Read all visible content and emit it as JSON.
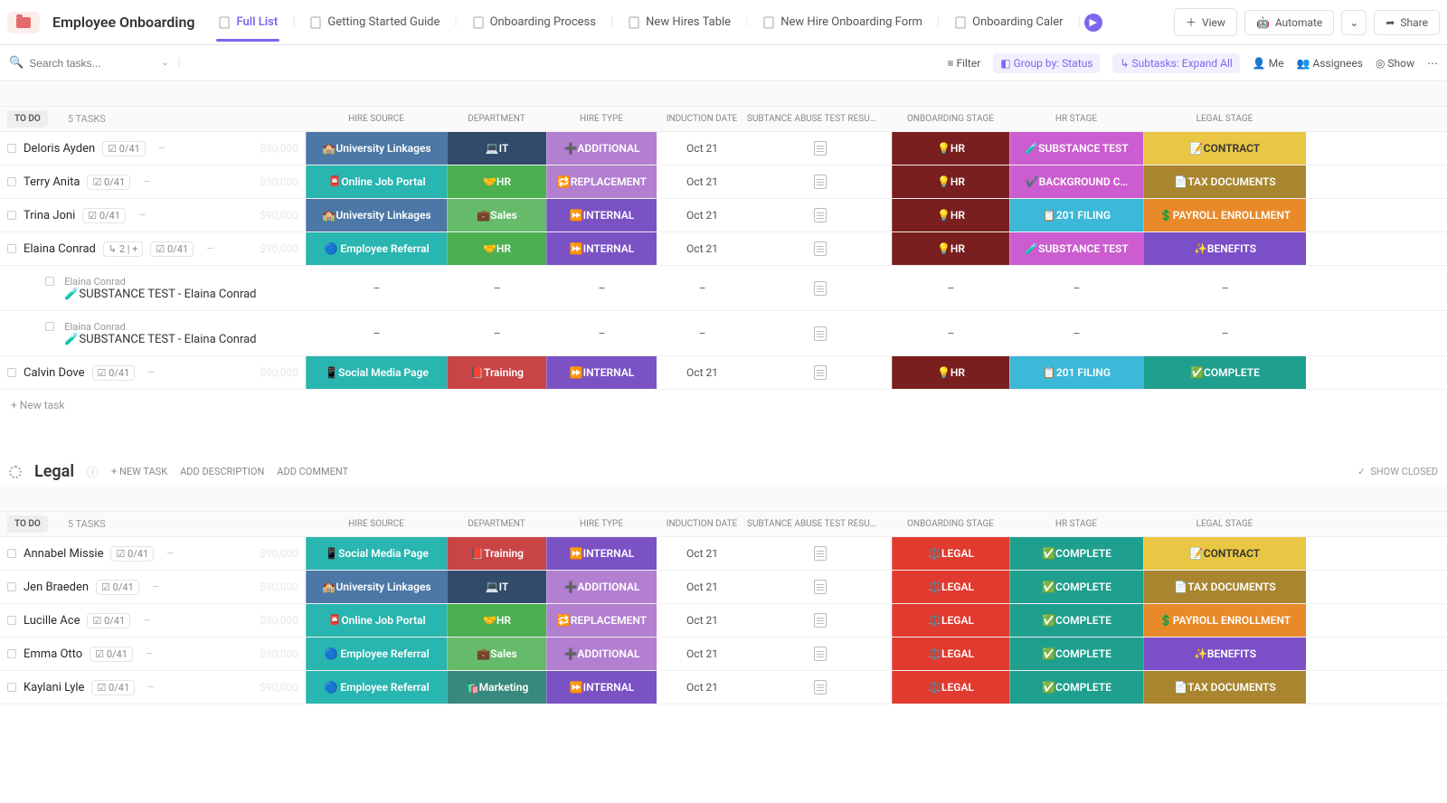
{
  "header": {
    "title": "Employee Onboarding",
    "tabs": [
      {
        "label": "Full List",
        "active": true
      },
      {
        "label": "Getting Started Guide"
      },
      {
        "label": "Onboarding Process"
      },
      {
        "label": "New Hires Table"
      },
      {
        "label": "New Hire Onboarding Form"
      },
      {
        "label": "Onboarding Caler"
      }
    ],
    "view_btn": "View",
    "automate_btn": "Automate",
    "share_btn": "Share"
  },
  "toolbar": {
    "search_placeholder": "Search tasks...",
    "filter": "Filter",
    "group_by": "Group by: Status",
    "subtasks": "Subtasks: Expand All",
    "me": "Me",
    "assignees": "Assignees",
    "show": "Show"
  },
  "columns": [
    "HIRE SOURCE",
    "DEPARTMENT",
    "HIRE TYPE",
    "INDUCTION DATE",
    "SUBTANCE ABUSE TEST RESU…",
    "ONBOARDING STAGE",
    "HR STAGE",
    "LEGAL STAGE"
  ],
  "group1": {
    "status": "TO DO",
    "task_count": "5 TASKS",
    "new_task": "+ New task",
    "rows": [
      {
        "name": "Deloris Ayden",
        "progress": "0/41",
        "budget": "$90,000",
        "hiresource": "🏫University Linkages",
        "hiresource_bg": "bg-steel",
        "dept": "💻IT",
        "dept_bg": "bg-it",
        "hiretype": "➕ADDITIONAL",
        "hiretype_bg": "bg-violetlight",
        "induction": "Oct 21",
        "onboarding": "💡HR",
        "onboarding_bg": "bg-maroon",
        "hrstage": "🧪SUBSTANCE TEST",
        "hrstage_bg": "bg-magenta",
        "legal": "📝CONTRACT",
        "legal_bg": "bg-mustard"
      },
      {
        "name": "Terry Anita",
        "progress": "0/41",
        "budget": "$90,000",
        "hiresource": "📮Online Job Portal",
        "hiresource_bg": "bg-teal",
        "dept": "🤝HR",
        "dept_bg": "bg-hr",
        "hiretype": "🔁REPLACEMENT",
        "hiretype_bg": "bg-violetlight",
        "induction": "Oct 21",
        "onboarding": "💡HR",
        "onboarding_bg": "bg-maroon",
        "hrstage": "✔️BACKGROUND C…",
        "hrstage_bg": "bg-magenta",
        "legal": "📄TAX DOCUMENTS",
        "legal_bg": "bg-olive"
      },
      {
        "name": "Trina Joni",
        "progress": "0/41",
        "budget": "$90,000",
        "hiresource": "🏫University Linkages",
        "hiresource_bg": "bg-steel",
        "dept": "💼Sales",
        "dept_bg": "bg-sales",
        "hiretype": "⏩INTERNAL",
        "hiretype_bg": "bg-violet",
        "induction": "Oct 21",
        "onboarding": "💡HR",
        "onboarding_bg": "bg-maroon",
        "hrstage": "📋201 FILING",
        "hrstage_bg": "bg-cyan",
        "legal": "💲PAYROLL ENROLLMENT",
        "legal_bg": "bg-orange"
      },
      {
        "name": "Elaina Conrad",
        "progress": "0/41",
        "budget": "$90,000",
        "subcount": "2",
        "hiresource": "🔵 Employee Referral",
        "hiresource_bg": "bg-teal",
        "dept": "🤝HR",
        "dept_bg": "bg-hr",
        "hiretype": "⏩INTERNAL",
        "hiretype_bg": "bg-violet",
        "induction": "Oct 21",
        "onboarding": "💡HR",
        "onboarding_bg": "bg-maroon",
        "hrstage": "🧪SUBSTANCE TEST",
        "hrstage_bg": "bg-magenta",
        "legal": "✨BENEFITS",
        "legal_bg": "bg-purple",
        "subtasks": [
          {
            "parent": "Elaina Conrad",
            "title": "🧪SUBSTANCE TEST - Elaina Conrad"
          },
          {
            "parent": "Elaina Conrad",
            "title": "🧪SUBSTANCE TEST - Elaina Conrad"
          }
        ]
      },
      {
        "name": "Calvin Dove",
        "progress": "0/41",
        "budget": "$90,000",
        "hiresource": "📱Social Media Page",
        "hiresource_bg": "bg-teal",
        "dept": "📕Training",
        "dept_bg": "bg-training",
        "hiretype": "⏩INTERNAL",
        "hiretype_bg": "bg-violet",
        "induction": "Oct 21",
        "onboarding": "💡HR",
        "onboarding_bg": "bg-maroon",
        "hrstage": "📋201 FILING",
        "hrstage_bg": "bg-cyan",
        "legal": "✅COMPLETE",
        "legal_bg": "bg-tealdark"
      }
    ]
  },
  "group2": {
    "name": "Legal",
    "links": {
      "new_task": "+ NEW TASK",
      "add_desc": "ADD DESCRIPTION",
      "add_comment": "ADD COMMENT",
      "show_closed": "SHOW CLOSED"
    },
    "status": "TO DO",
    "task_count": "5 TASKS",
    "rows": [
      {
        "name": "Annabel Missie",
        "progress": "0/41",
        "budget": "$90,000",
        "hiresource": "📱Social Media Page",
        "hiresource_bg": "bg-teal",
        "dept": "📕Training",
        "dept_bg": "bg-training",
        "hiretype": "⏩INTERNAL",
        "hiretype_bg": "bg-violet",
        "induction": "Oct 21",
        "onboarding": "⚖️LEGAL",
        "onboarding_bg": "bg-red",
        "hrstage": "✅COMPLETE",
        "hrstage_bg": "bg-tealdark",
        "legal": "📝CONTRACT",
        "legal_bg": "bg-mustard"
      },
      {
        "name": "Jen Braeden",
        "progress": "0/41",
        "budget": "$90,000",
        "hiresource": "🏫University Linkages",
        "hiresource_bg": "bg-steel",
        "dept": "💻IT",
        "dept_bg": "bg-it",
        "hiretype": "➕ADDITIONAL",
        "hiretype_bg": "bg-violetlight",
        "induction": "Oct 21",
        "onboarding": "⚖️LEGAL",
        "onboarding_bg": "bg-red",
        "hrstage": "✅COMPLETE",
        "hrstage_bg": "bg-tealdark",
        "legal": "📄TAX DOCUMENTS",
        "legal_bg": "bg-olive"
      },
      {
        "name": "Lucille Ace",
        "progress": "0/41",
        "budget": "$90,000",
        "hiresource": "📮Online Job Portal",
        "hiresource_bg": "bg-teal",
        "dept": "🤝HR",
        "dept_bg": "bg-hr",
        "hiretype": "🔁REPLACEMENT",
        "hiretype_bg": "bg-violetlight",
        "induction": "Oct 21",
        "onboarding": "⚖️LEGAL",
        "onboarding_bg": "bg-red",
        "hrstage": "✅COMPLETE",
        "hrstage_bg": "bg-tealdark",
        "legal": "💲PAYROLL ENROLLMENT",
        "legal_bg": "bg-orange"
      },
      {
        "name": "Emma Otto",
        "progress": "0/41",
        "budget": "$90,000",
        "hiresource": "🔵 Employee Referral",
        "hiresource_bg": "bg-teal",
        "dept": "💼Sales",
        "dept_bg": "bg-sales",
        "hiretype": "➕ADDITIONAL",
        "hiretype_bg": "bg-violetlight",
        "induction": "Oct 21",
        "onboarding": "⚖️LEGAL",
        "onboarding_bg": "bg-red",
        "hrstage": "✅COMPLETE",
        "hrstage_bg": "bg-tealdark",
        "legal": "✨BENEFITS",
        "legal_bg": "bg-purple"
      },
      {
        "name": "Kaylani Lyle",
        "progress": "0/41",
        "budget": "$90,000",
        "hiresource": "🔵 Employee Referral",
        "hiresource_bg": "bg-teal",
        "dept": "🛍️Marketing",
        "dept_bg": "bg-marketing",
        "hiretype": "⏩INTERNAL",
        "hiretype_bg": "bg-violet",
        "induction": "Oct 21",
        "onboarding": "⚖️LEGAL",
        "onboarding_bg": "bg-red",
        "hrstage": "✅COMPLETE",
        "hrstage_bg": "bg-tealdark",
        "legal": "📄TAX DOCUMENTS",
        "legal_bg": "bg-olive"
      }
    ]
  }
}
